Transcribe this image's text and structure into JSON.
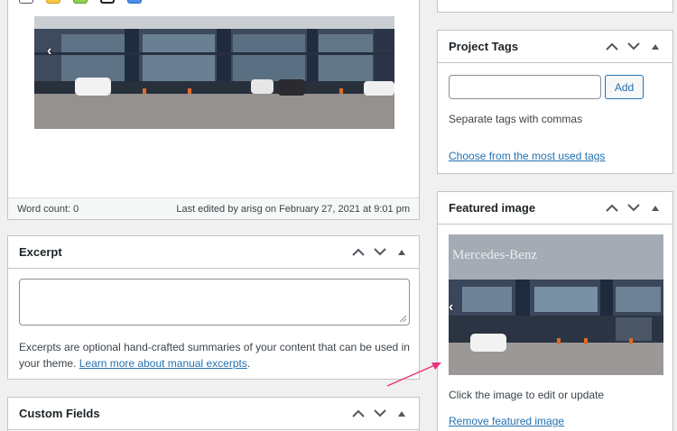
{
  "editor": {
    "word_count": "Word count: 0",
    "last_edited": "Last edited by arisg on February 27, 2021 at 9:01 pm"
  },
  "excerpt": {
    "title": "Excerpt",
    "help_text": "Excerpts are optional hand-crafted summaries of your content that can be used in your theme.",
    "link_text": "Learn more about manual excerpts",
    "link_suffix": "."
  },
  "custom_fields": {
    "title": "Custom Fields"
  },
  "project_tags": {
    "title": "Project Tags",
    "input_value": "",
    "add_label": "Add",
    "help_text": "Separate tags with commas",
    "most_used_link": "Choose from the most used tags"
  },
  "featured_image": {
    "title": "Featured image",
    "sign_text": "Mercedes-Benz",
    "help_text": "Click the image to edit or update",
    "remove_link": "Remove featured image"
  },
  "colors": {
    "link": "#2271b1",
    "border": "#c3c4c7",
    "background": "#f0f0f1",
    "annotation_arrow": "#e8327a"
  },
  "icons": {
    "move_up": "chevron-up-icon",
    "move_down": "chevron-down-icon",
    "toggle": "triangle-up-icon"
  }
}
